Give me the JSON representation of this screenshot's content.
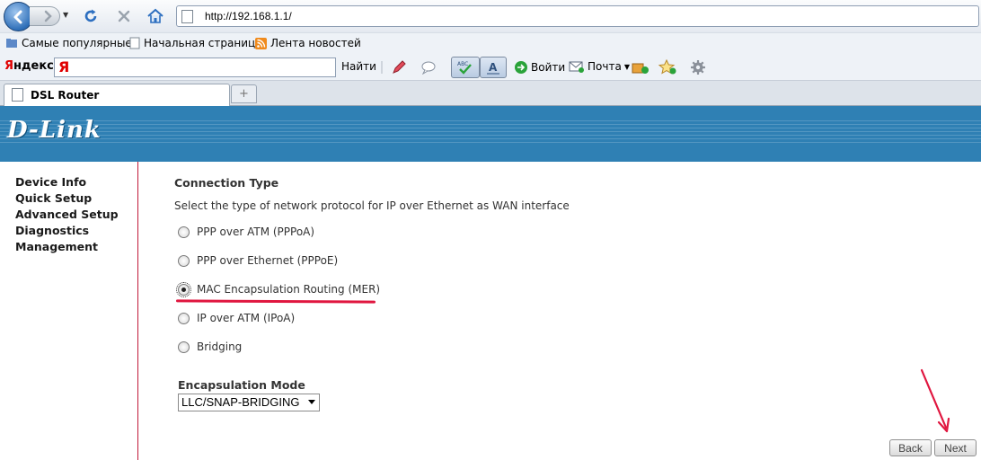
{
  "browser": {
    "address": "http://192.168.1.1/",
    "bookmarks": [
      "Самые популярные",
      "Начальная страница",
      "Лента новостей"
    ],
    "toolbar": {
      "brand": "Яндекс",
      "search_logo": "Я",
      "find": "Найти",
      "login": "Войти",
      "mail": "Почта"
    },
    "tab_title": "DSL Router",
    "icons": [
      "back-icon",
      "forward-icon",
      "refresh-icon",
      "stop-icon",
      "home-icon",
      "gear-icon",
      "star-icon",
      "mail-icon"
    ]
  },
  "router": {
    "brand": "D-Link",
    "brand_color": "#2f80b4",
    "menu": [
      "Device Info",
      "Quick Setup",
      "Advanced Setup",
      "Diagnostics",
      "Management"
    ],
    "connection_type": {
      "title": "Connection Type",
      "description": "Select the type of network protocol for IP over Ethernet as WAN interface",
      "options": [
        {
          "label": "PPP over ATM (PPPoA)",
          "selected": false
        },
        {
          "label": "PPP over Ethernet (PPPoE)",
          "selected": false
        },
        {
          "label": "MAC Encapsulation Routing (MER)",
          "selected": true
        },
        {
          "label": "IP over ATM (IPoA)",
          "selected": false
        },
        {
          "label": "Bridging",
          "selected": false
        }
      ]
    },
    "encapsulation": {
      "title": "Encapsulation Mode",
      "value": "LLC/SNAP-BRIDGING"
    },
    "buttons": {
      "back": "Back",
      "next": "Next"
    },
    "annotation_color": "#e0163f"
  }
}
